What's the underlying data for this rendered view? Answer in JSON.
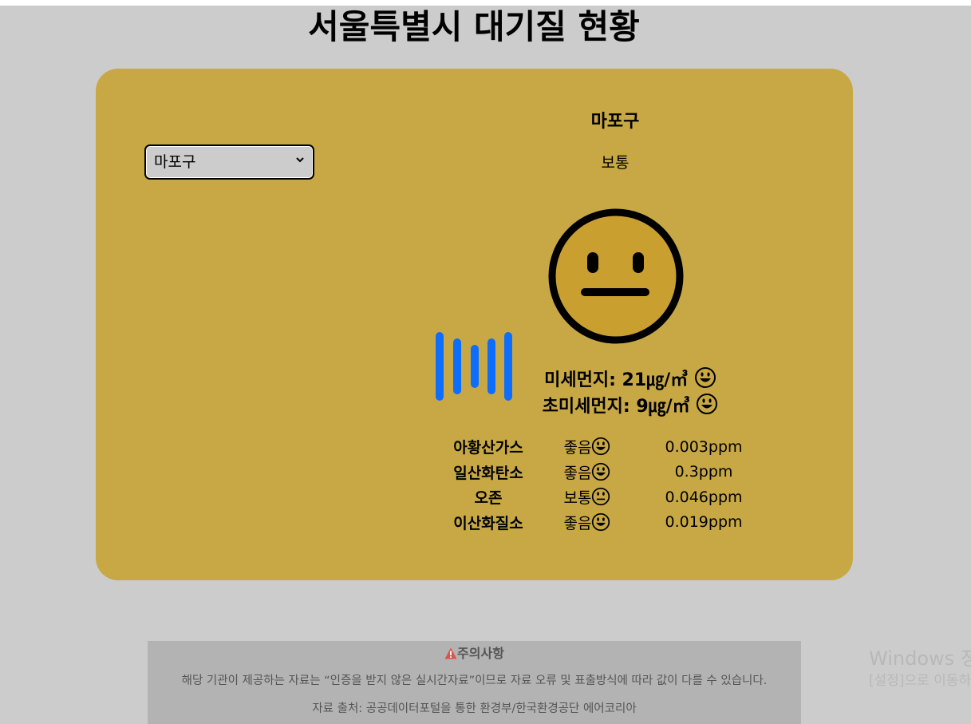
{
  "page": {
    "title": "서울특별시 대기질 현황"
  },
  "selector": {
    "selected": "마포구",
    "options": [
      "마포구"
    ]
  },
  "district": {
    "name": "마포구",
    "status": "보통",
    "face_icon": "neutral-face-icon"
  },
  "particulates": {
    "pm10_label": "미세먼지: 21㎍/㎥",
    "pm10_icon": "grinning-face-icon",
    "pm25_label": "초미세먼지: 9㎍/㎥",
    "pm25_icon": "grinning-face-icon"
  },
  "gases": [
    {
      "name": "아황산가스",
      "grade": "좋음",
      "icon": "grinning-face-icon",
      "value": "0.003ppm"
    },
    {
      "name": "일산화탄소",
      "grade": "좋음",
      "icon": "grinning-face-icon",
      "value": "0.3ppm"
    },
    {
      "name": "오존",
      "grade": "보통",
      "icon": "neutral-face-icon",
      "value": "0.046ppm"
    },
    {
      "name": "이산화질소",
      "grade": "좋음",
      "icon": "grinning-face-icon",
      "value": "0.019ppm"
    }
  ],
  "notice": {
    "title": "주의사항",
    "icon": "warning-icon",
    "body": "해당 기관이 제공하는 자료는 “인증을 받지 않은 실시간자료”이므로 자료 오류 및 표출방식에 따라 값이 다를 수 있습니다.",
    "source": "자료 출처: 공공데이터포털을 통한 환경부/한국환경공단 에어코리아"
  },
  "watermark": {
    "line1": "Windows 정",
    "line2": "[설정]으로 이동하"
  },
  "colors": {
    "background": "#cccccc",
    "card": "#c8a845",
    "face_fill": "#c9a030",
    "loader_bar": "#0d6efd",
    "warning": "#d9534f"
  }
}
